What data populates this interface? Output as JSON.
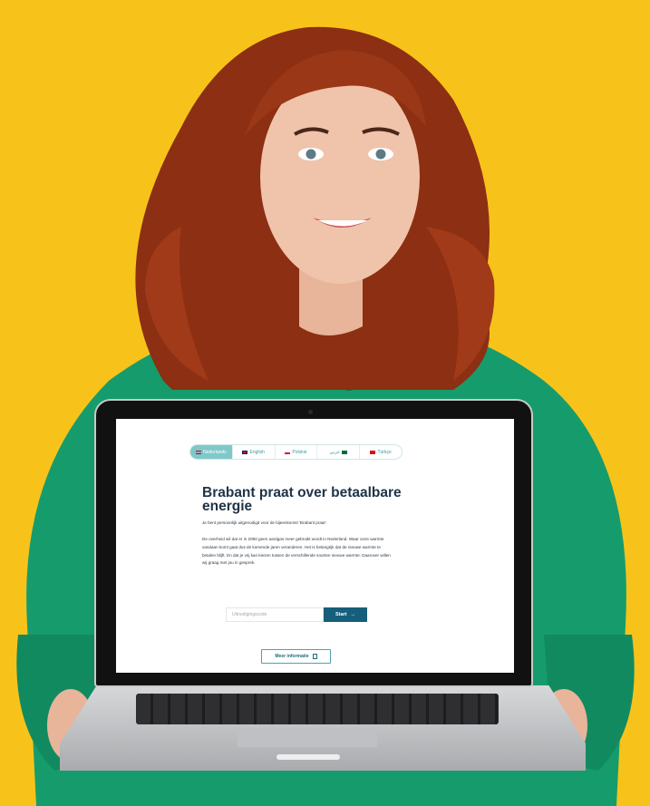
{
  "languages": [
    {
      "label": "Nederlands",
      "active": true
    },
    {
      "label": "English",
      "active": false
    },
    {
      "label": "Polskie",
      "active": false
    },
    {
      "label": "عربي",
      "active": false
    },
    {
      "label": "Türkçe",
      "active": false
    }
  ],
  "hero": {
    "title": "Brabant praat over betaalbare energie",
    "intro": "Je bent persoonlijk uitgenodigd voor de bijeenkomst 'Brabant praat'.",
    "body": "De overheid wil dat er in 2050 geen aardgas meer gebruikt wordt in Nederland. Waar onze warmte vandaan komt gaat dus de komende jaren veranderen. Het is belangrijk dat de nieuwe warmte te betalen blijft. En dat je vrij kan kiezen tussen de verschillende soorten nieuwe warmte. Daarover willen wij graag met jou in gesprek."
  },
  "form": {
    "code_placeholder": "Uitnodigingscode",
    "start_label": "Start",
    "start_arrow": "→"
  },
  "info_button": {
    "label": "Meer informatie"
  },
  "colors": {
    "background": "#f7c31b",
    "accent_teal": "#7fc8c8",
    "primary_button": "#155f7a",
    "title_text": "#1f3346"
  }
}
